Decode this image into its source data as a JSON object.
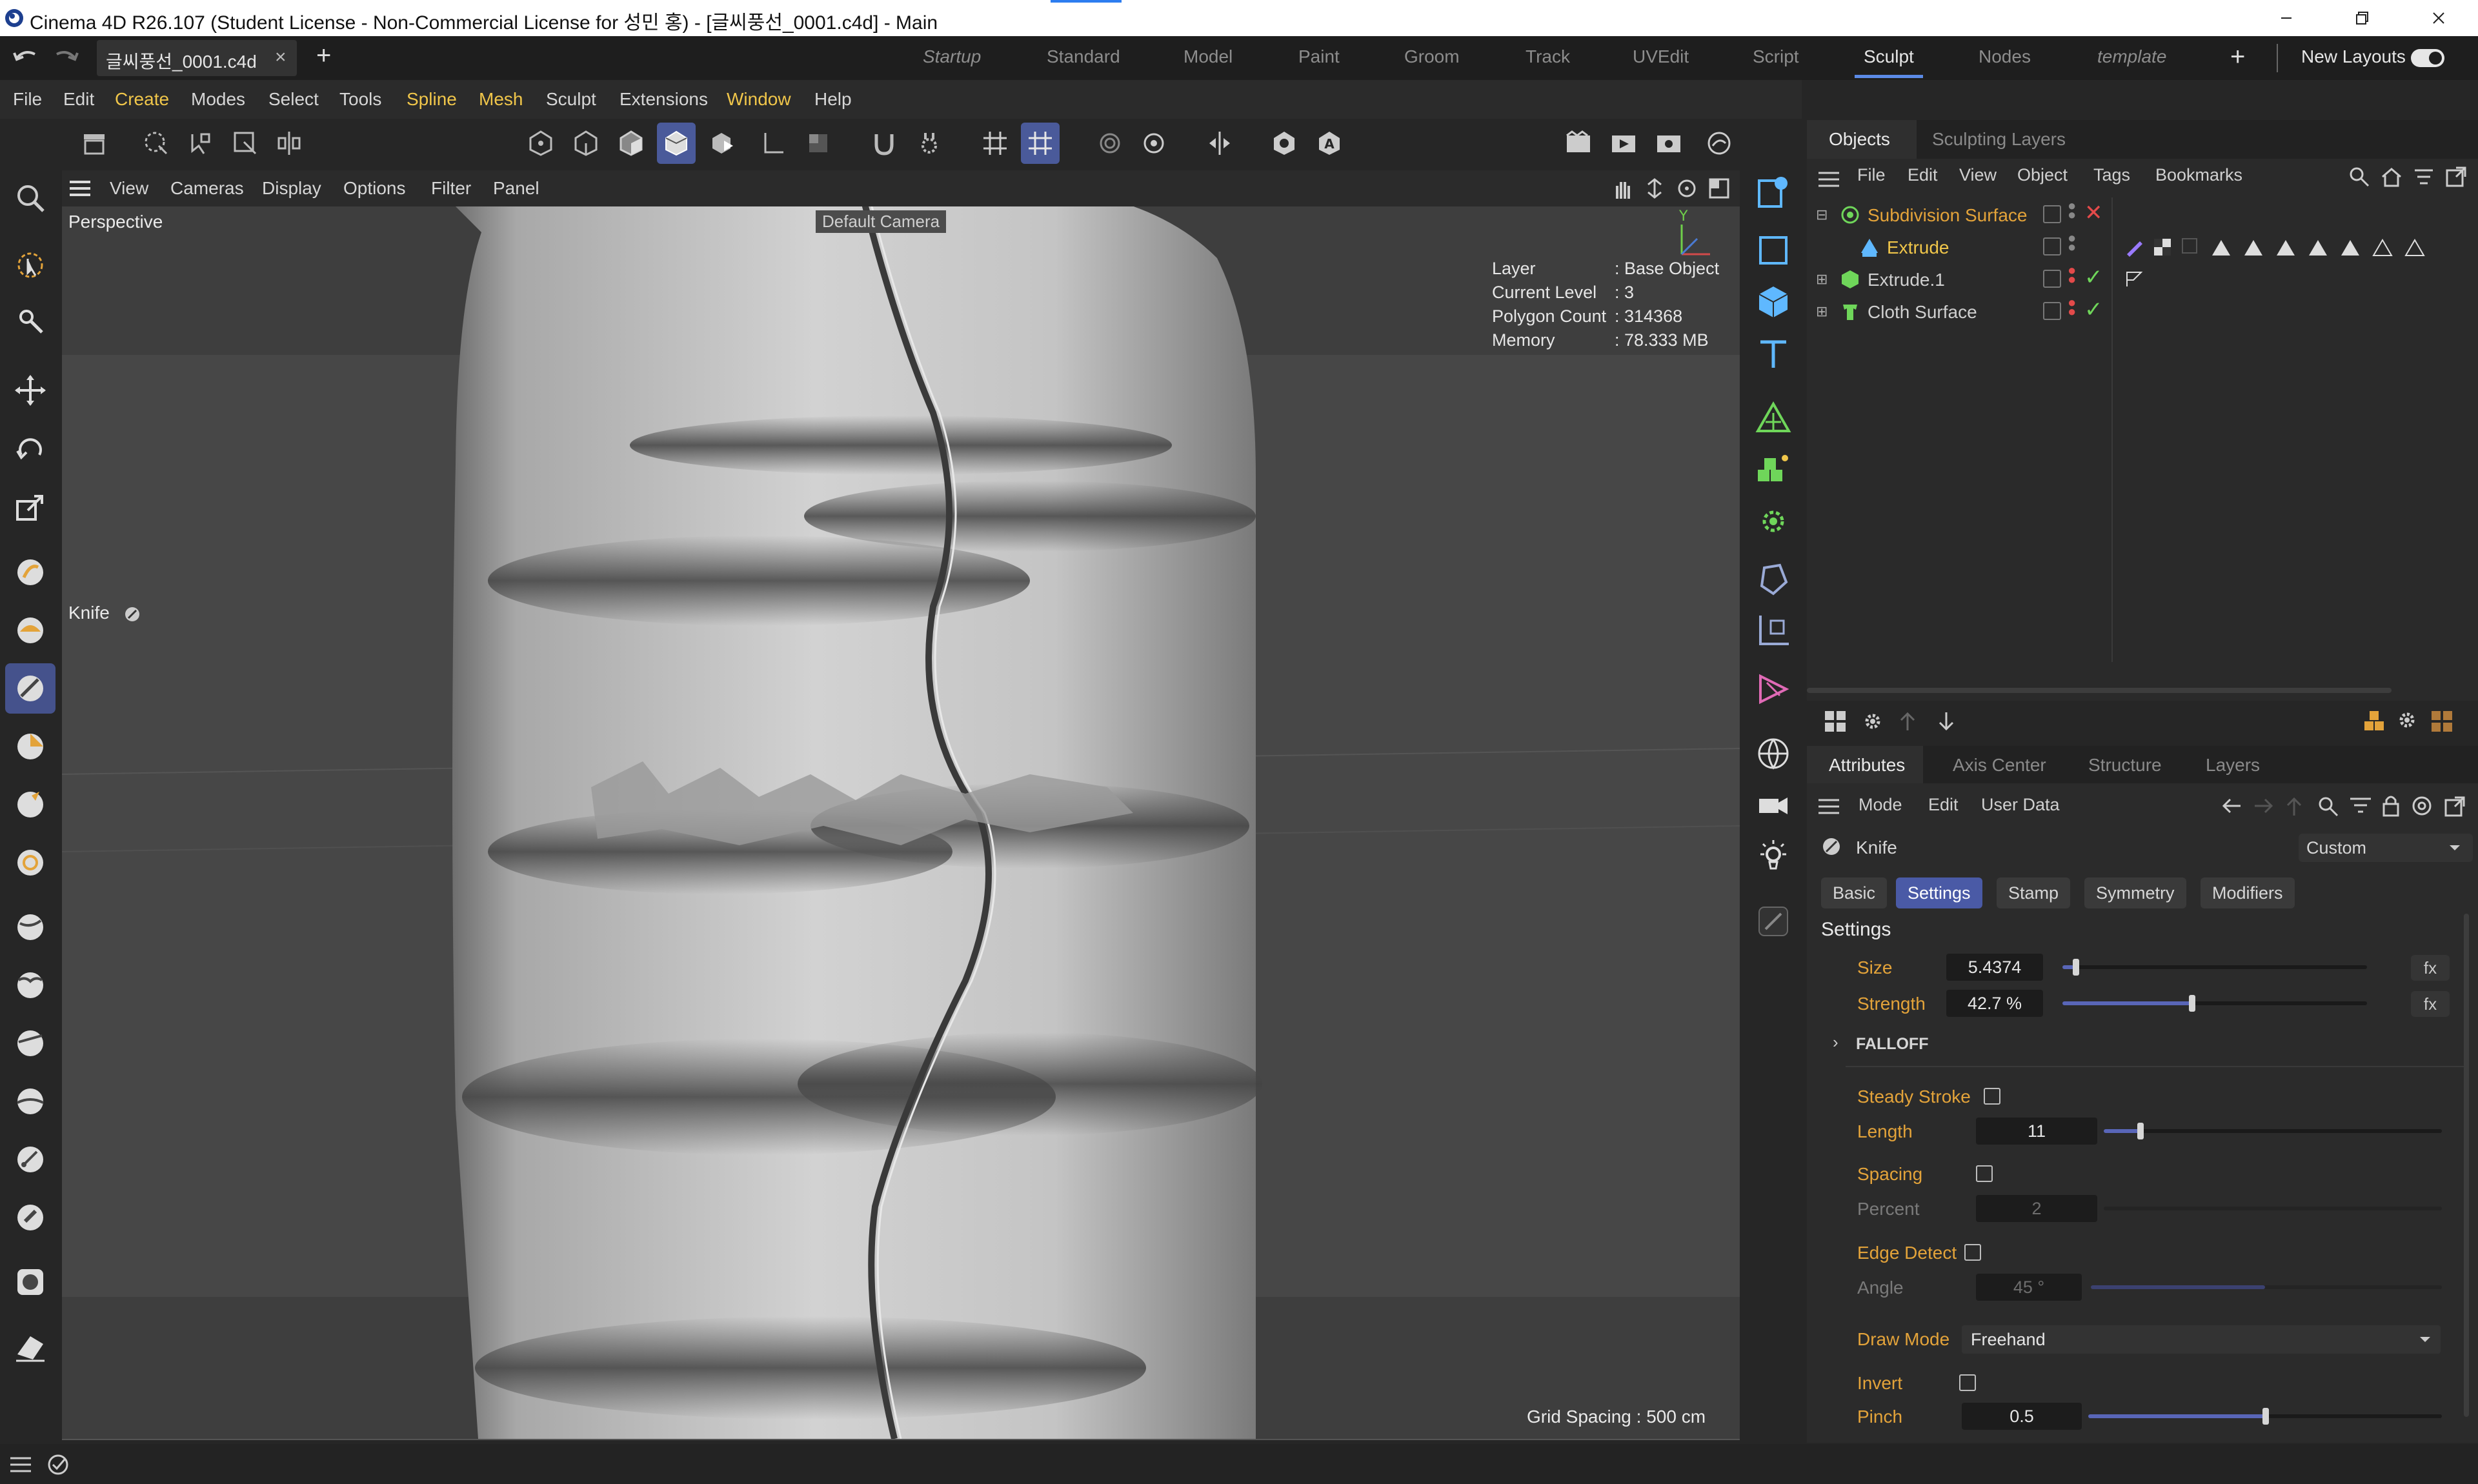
{
  "window": {
    "title": "Cinema 4D R26.107 (Student License - Non-Commercial License for 성민 홍) - [글씨풍선_0001.c4d] - Main"
  },
  "tabbar": {
    "file_tab": "글씨풍선_0001.c4d",
    "layouts": [
      "Startup",
      "Standard",
      "Model",
      "Paint",
      "Groom",
      "Track",
      "UVEdit",
      "Script",
      "Sculpt",
      "Nodes",
      "template"
    ],
    "active_layout": "Sculpt",
    "new_layouts": "New Layouts"
  },
  "menubar": {
    "items": [
      "File",
      "Edit",
      "Create",
      "Modes",
      "Select",
      "Tools",
      "Spline",
      "Mesh",
      "Sculpt",
      "Extensions",
      "Window",
      "Help"
    ]
  },
  "viewport": {
    "menu": [
      "View",
      "Cameras",
      "Display",
      "Options",
      "Filter",
      "Panel"
    ],
    "view_label": "Perspective",
    "camera_label": "Default Camera",
    "active_tool_label": "Knife",
    "hud": {
      "layer_key": "Layer",
      "layer_value": ": Base Object",
      "level_key": "Current Level",
      "level_value": ": 3",
      "poly_key": "Polygon Count",
      "poly_value": ": 314368",
      "memory_key": "Memory",
      "memory_value": ": 78.333 MB"
    },
    "grid_spacing": "Grid Spacing : 500 cm",
    "axis_y": "Y"
  },
  "objects_panel": {
    "tabs": [
      "Objects",
      "Sculpting Layers"
    ],
    "menu": [
      "File",
      "Edit",
      "View",
      "Object",
      "Tags",
      "Bookmarks"
    ],
    "rows": [
      {
        "name": "Subdivision Surface",
        "color": "#e3a33a"
      },
      {
        "name": "Extrude",
        "color": "#f0c64a"
      },
      {
        "name": "Extrude.1",
        "color": "#cfcfcf"
      },
      {
        "name": "Cloth Surface",
        "color": "#cfcfcf"
      }
    ]
  },
  "attributes_panel": {
    "tabs": [
      "Attributes",
      "Axis Center",
      "Structure",
      "Layers"
    ],
    "menu": [
      "Mode",
      "Edit",
      "User Data"
    ],
    "tool_name": "Knife",
    "preset": "Custom",
    "sub_tabs": [
      "Basic",
      "Settings",
      "Stamp",
      "Symmetry",
      "Modifiers"
    ],
    "active_sub_tab": "Settings",
    "section_title": "Settings",
    "size_label": "Size",
    "size_value": "5.4374",
    "size_fraction": 0.04,
    "strength_label": "Strength",
    "strength_value": "42.7 %",
    "strength_fraction": 0.427,
    "fx_label": "fx",
    "falloff_label": "FALLOFF",
    "steady_stroke_label": "Steady Stroke",
    "length_label": "Length",
    "length_value": "11",
    "spacing_label": "Spacing",
    "percent_label": "Percent",
    "percent_value": "2",
    "edge_detect_label": "Edge Detect",
    "angle_label": "Angle",
    "angle_value": "45 °",
    "draw_mode_label": "Draw Mode",
    "draw_mode_value": "Freehand",
    "invert_label": "Invert",
    "pinch_label": "Pinch",
    "pinch_value": "0.5",
    "pinch_fraction": 0.5
  },
  "colors": {
    "accent_blue": "#4a5aa6",
    "label_orange": "#e3a33a",
    "menu_highlight": "#f0c64a"
  }
}
